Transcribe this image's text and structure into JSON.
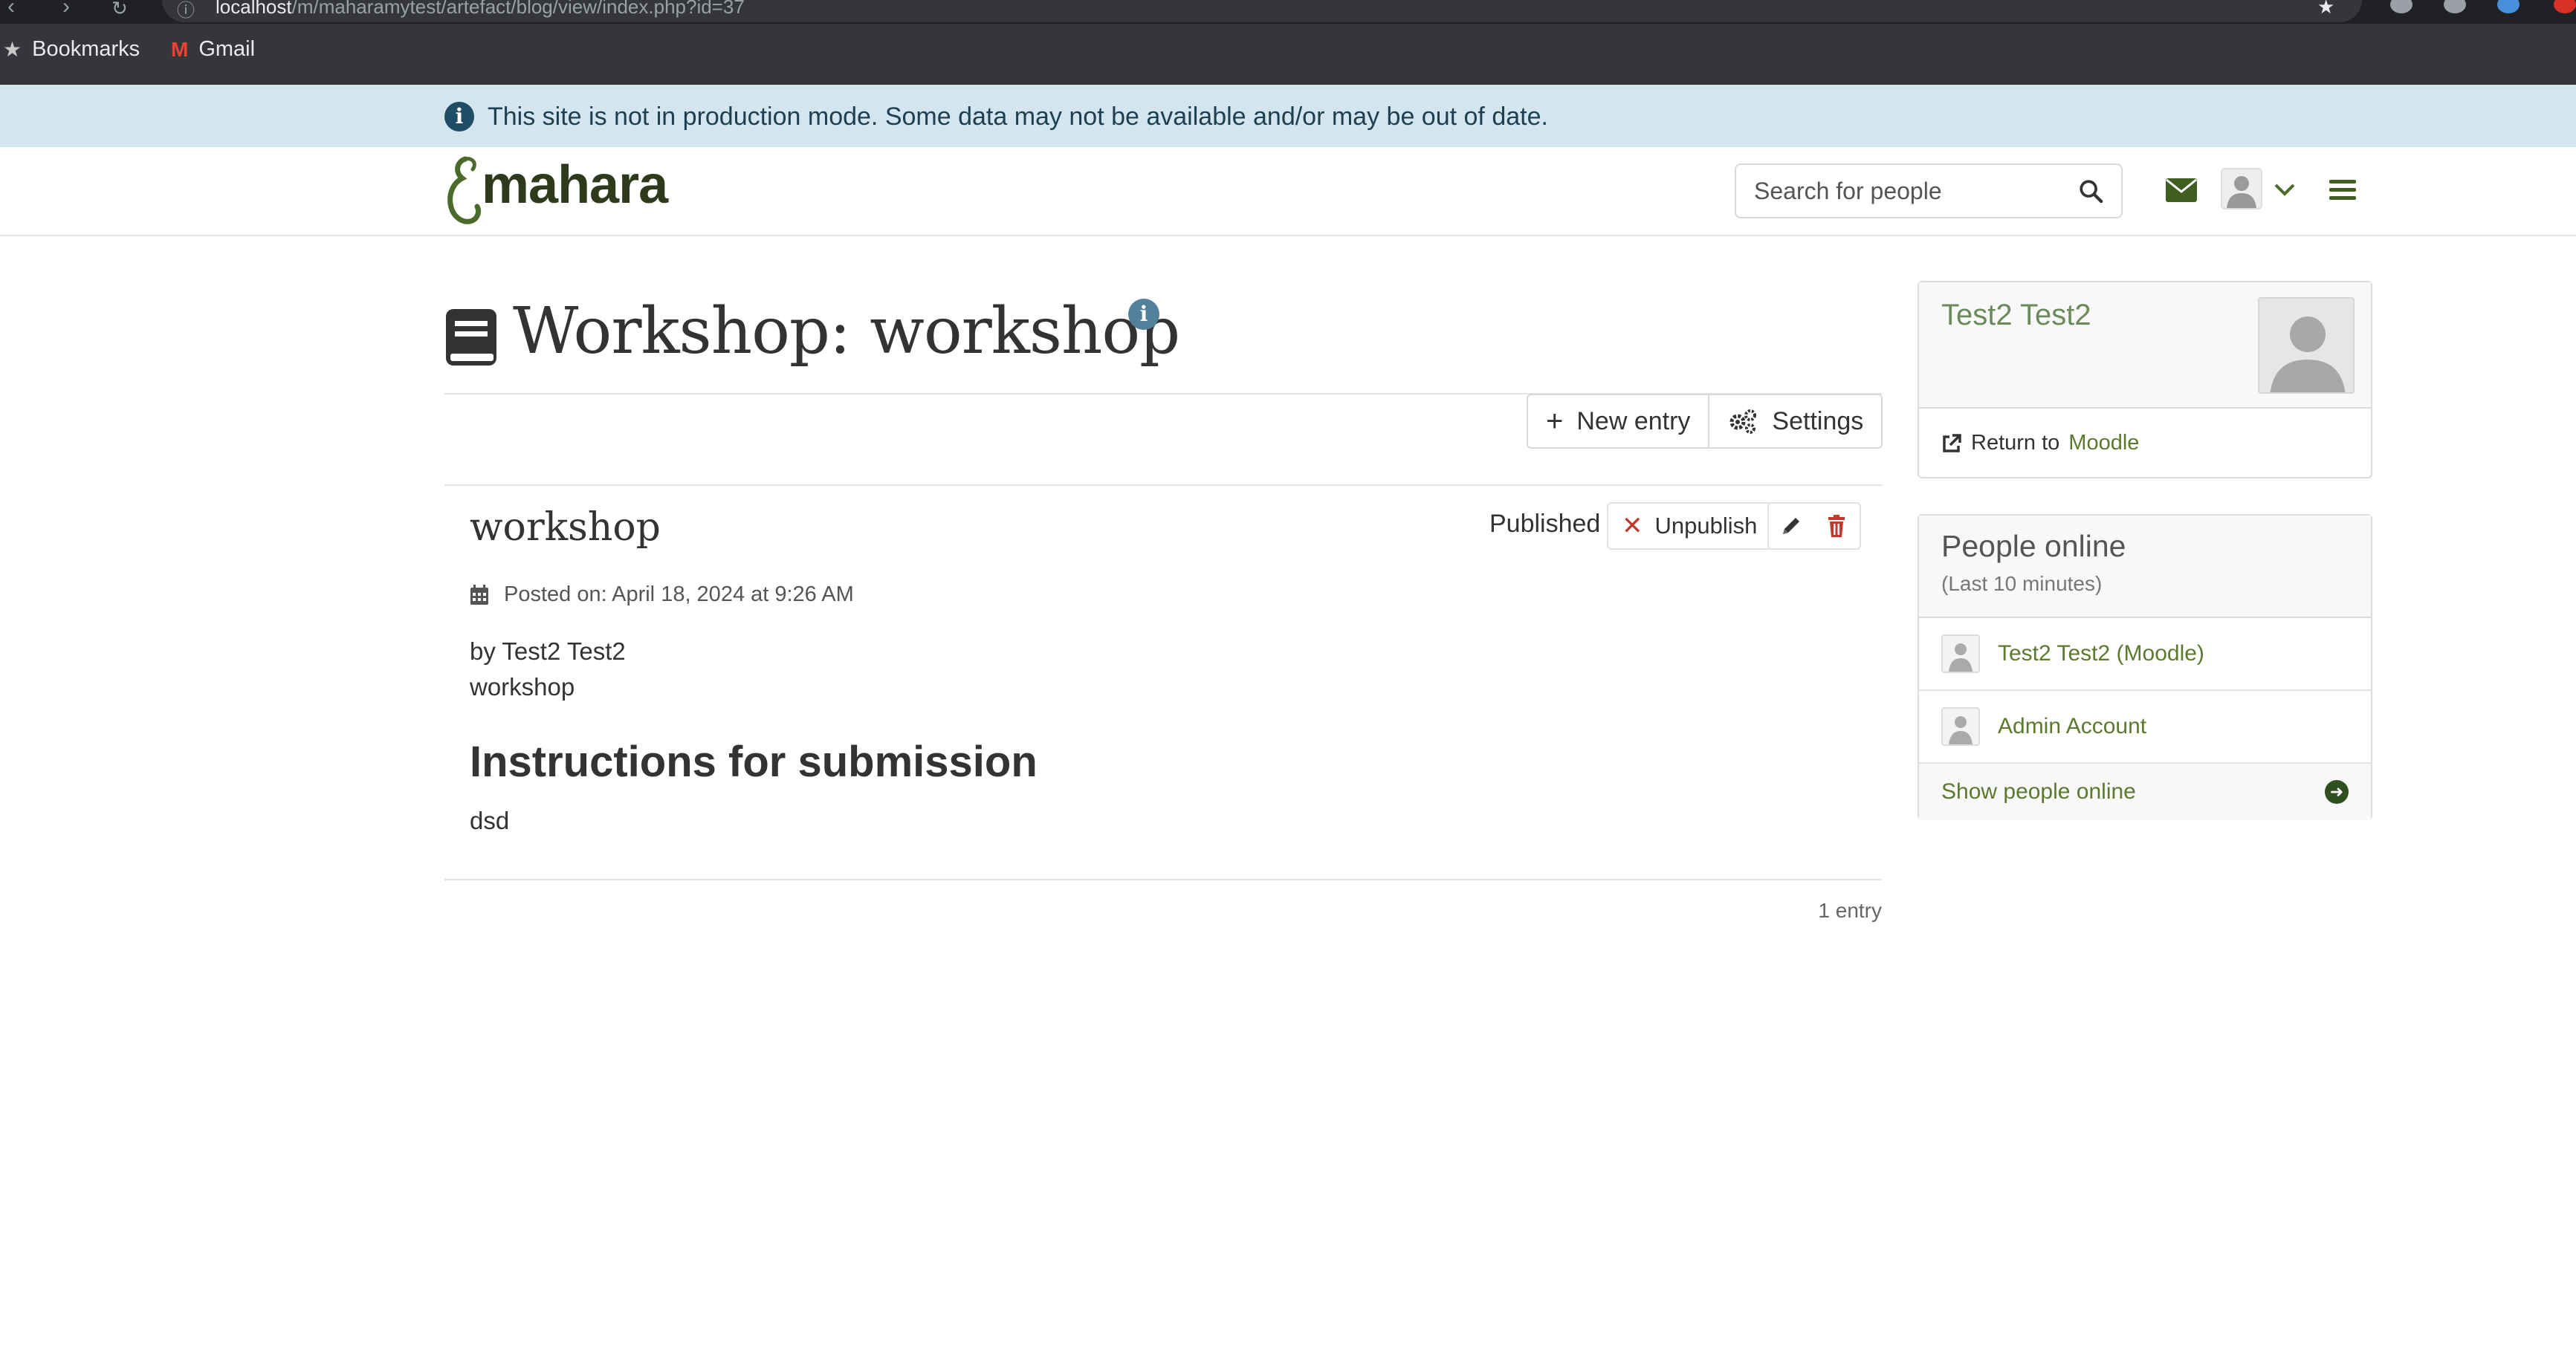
{
  "browser": {
    "url_host": "localhost",
    "url_path": "/m/maharamytest/artefact/blog/view/index.php?id=37",
    "bookmarks": [
      {
        "label": "Bookmarks",
        "icon": "star-icon"
      },
      {
        "label": "Gmail",
        "icon": "gmail-icon"
      }
    ]
  },
  "notice": {
    "text": "This site is not in production mode. Some data may not be available and/or may be out of date."
  },
  "header": {
    "logo_text": "mahara",
    "search_placeholder": "Search for people"
  },
  "page": {
    "title": "Workshop: workshop",
    "buttons": {
      "new_entry": "New entry",
      "settings": "Settings"
    }
  },
  "entry": {
    "title": "workshop",
    "status": "Published",
    "unpublish_label": "Unpublish",
    "posted_on": "Posted on: April 18, 2024 at 9:26 AM",
    "author": "by Test2 Test2",
    "tags_line": "workshop",
    "heading": "Instructions for submission",
    "body": "dsd",
    "count": "1 entry"
  },
  "sidebar": {
    "user": {
      "name": "Test2 Test2",
      "return_prefix": "Return to",
      "return_link": "Moodle"
    },
    "people_online": {
      "title": "People online",
      "subtitle": "(Last 10 minutes)",
      "people": [
        "Test2 Test2 (Moodle)",
        "Admin Account"
      ],
      "footer_link": "Show people online"
    }
  },
  "colors": {
    "brand_green": "#5b7a2e",
    "notice_bg": "#d3e6f0",
    "danger_red": "#c0392b"
  }
}
